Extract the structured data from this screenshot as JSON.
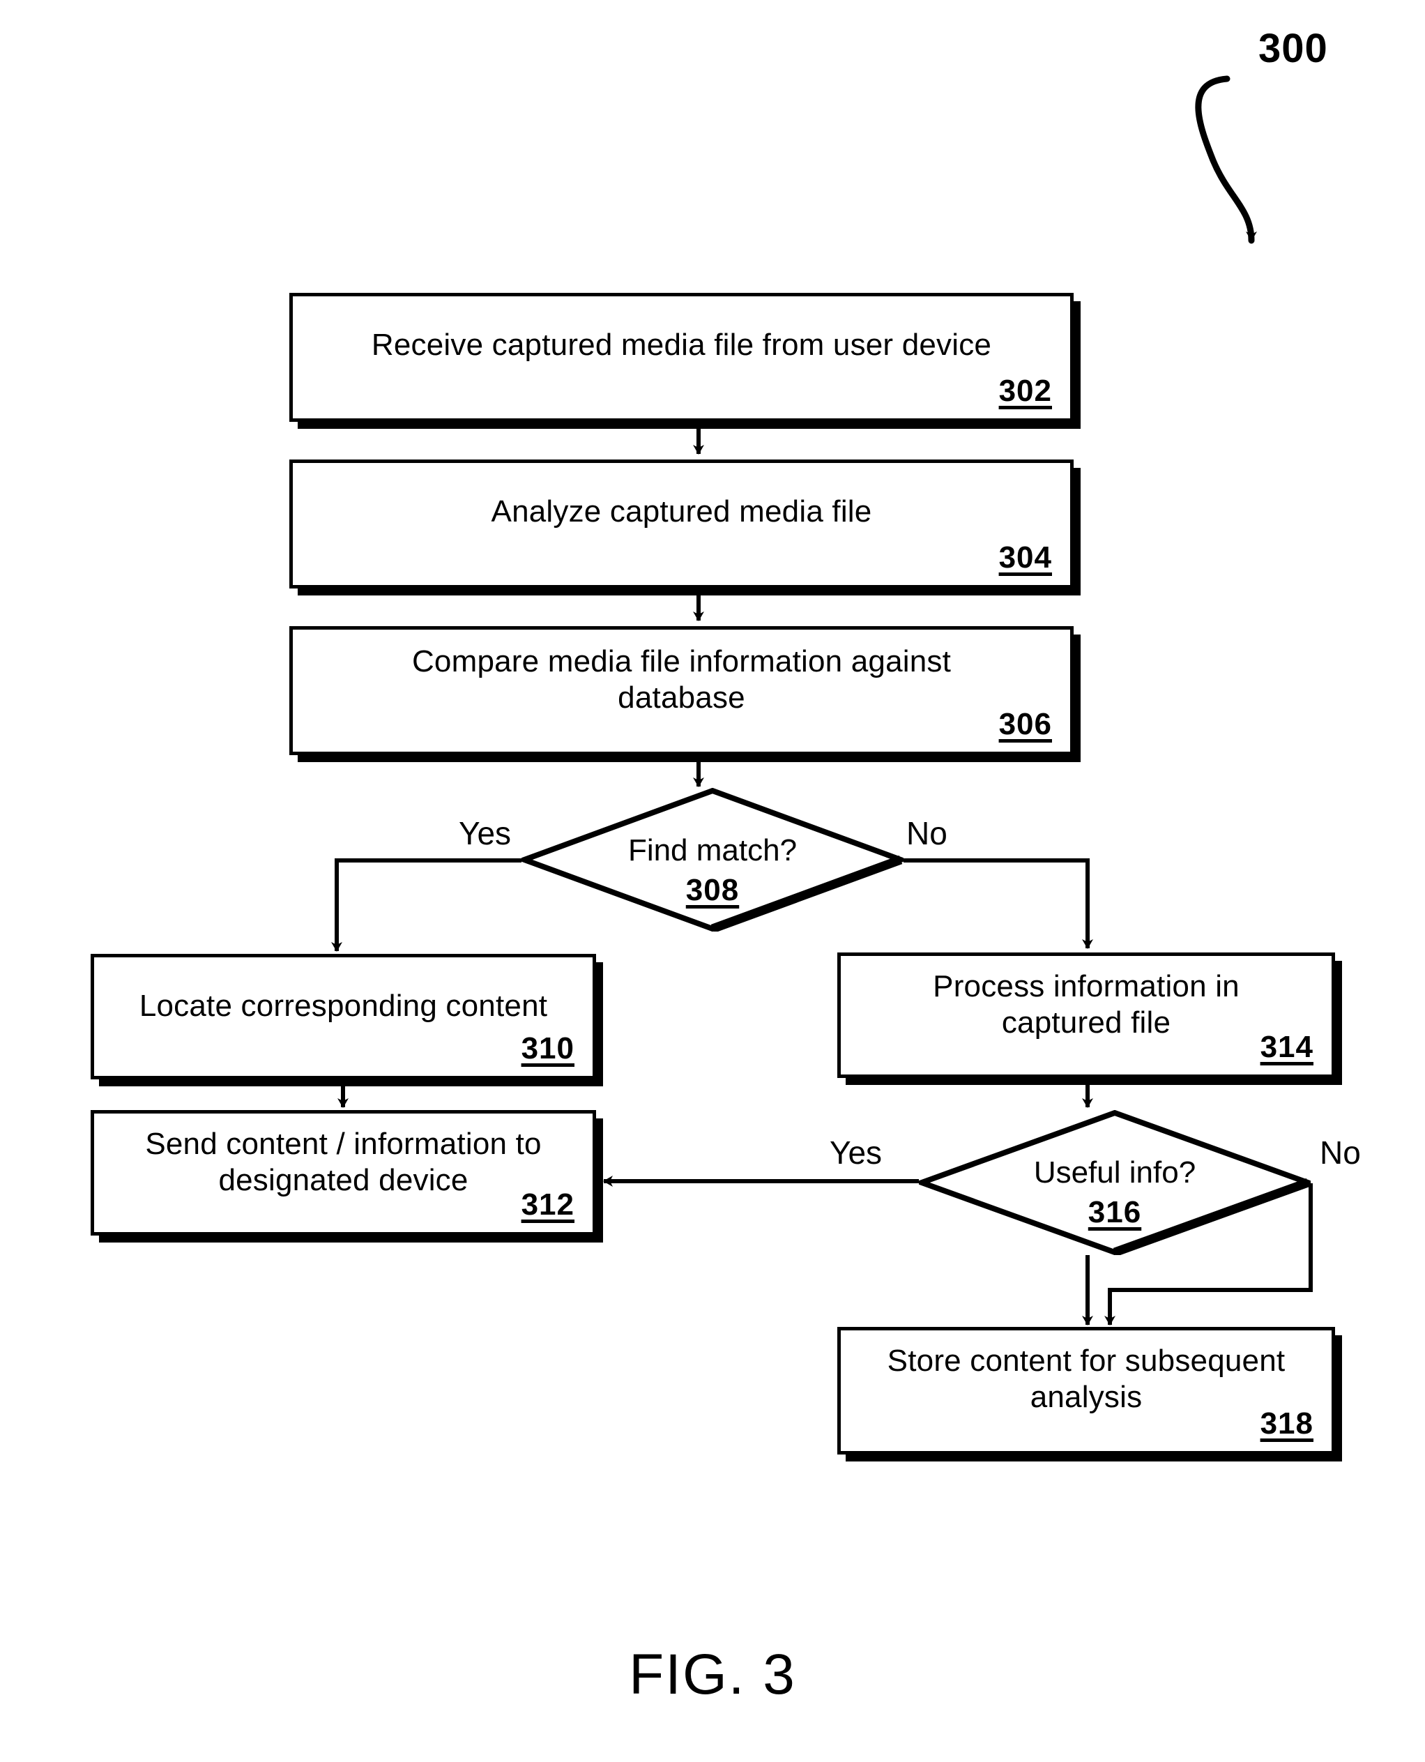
{
  "figure": {
    "caption": "FIG. 3",
    "reference_number": "300"
  },
  "nodes": [
    {
      "id": "302",
      "shape": "process",
      "text": "Receive captured media file from user device",
      "ref": "302"
    },
    {
      "id": "304",
      "shape": "process",
      "text": "Analyze captured media file",
      "ref": "304"
    },
    {
      "id": "306",
      "shape": "process",
      "text": "Compare media file information against database",
      "ref": "306"
    },
    {
      "id": "308",
      "shape": "decision",
      "text": "Find match?",
      "ref": "308"
    },
    {
      "id": "310",
      "shape": "process",
      "text": "Locate corresponding content",
      "ref": "310"
    },
    {
      "id": "312",
      "shape": "process",
      "text": "Send content / information to designated device",
      "ref": "312"
    },
    {
      "id": "314",
      "shape": "process",
      "text": "Process information in captured file",
      "ref": "314"
    },
    {
      "id": "316",
      "shape": "decision",
      "text": "Useful info?",
      "ref": "316"
    },
    {
      "id": "318",
      "shape": "process",
      "text": "Store content for subsequent analysis",
      "ref": "318"
    }
  ],
  "edge_labels": {
    "match_yes": "Yes",
    "match_no": "No",
    "useful_yes": "Yes",
    "useful_no": "No"
  },
  "colors": {
    "line": "#000000",
    "fill": "#ffffff",
    "text": "#000000"
  }
}
